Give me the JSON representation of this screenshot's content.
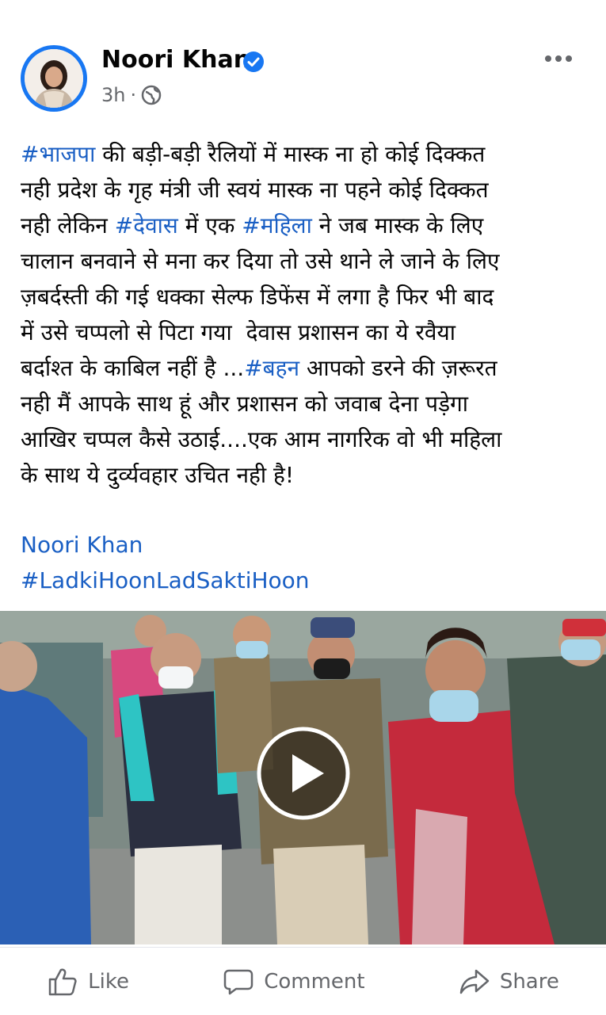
{
  "post": {
    "author": "Noori Khan",
    "time": "3h",
    "separator": "·",
    "lines": [
      [
        {
          "t": "#भाजपा",
          "tag": true
        },
        {
          "t": " की बड़ी-बड़ी रैलियों में मास्क ना हो कोई दिक्कत"
        }
      ],
      [
        {
          "t": "नही प्रदेश के गृह मंत्री जी स्वयं मास्क ना पहने कोई दिक्कत"
        }
      ],
      [
        {
          "t": "नही लेकिन "
        },
        {
          "t": "#देवास",
          "tag": true
        },
        {
          "t": " में एक "
        },
        {
          "t": "#महिला",
          "tag": true
        },
        {
          "t": " ने जब मास्क के लिए"
        }
      ],
      [
        {
          "t": "चालान बनवाने से मना कर दिया तो उसे थाने ले जाने के लिए"
        }
      ],
      [
        {
          "t": "ज़बर्दस्ती की गई धक्का सेल्फ डिफेंस में लगा है फिर भी बाद"
        }
      ],
      [
        {
          "t": "में उसे चप्पलो से पिटा गया  देवास प्रशासन का ये रवैया"
        }
      ],
      [
        {
          "t": "बर्दाश्त के काबिल नहीं है ..."
        },
        {
          "t": "#बहन",
          "tag": true
        },
        {
          "t": " आपको डरने की ज़रूरत"
        }
      ],
      [
        {
          "t": "नही मैं आपके साथ हूं और प्रशासन को जवाब देना पड़ेगा"
        }
      ],
      [
        {
          "t": "आखिर चप्पल कैसे उठाई....एक आम नागरिक वो भी महिला"
        }
      ],
      [
        {
          "t": "के साथ ये दुर्व्यवहार उचित नही है!"
        }
      ]
    ],
    "signature": "Noori Khan",
    "hashtag": "#LadkiHoonLadSaktiHoon"
  },
  "actions": {
    "like": "Like",
    "comment": "Comment",
    "share": "Share"
  },
  "colors": {
    "accent": "#1877f2",
    "link": "#1a5fc4",
    "muted": "#65676b"
  }
}
